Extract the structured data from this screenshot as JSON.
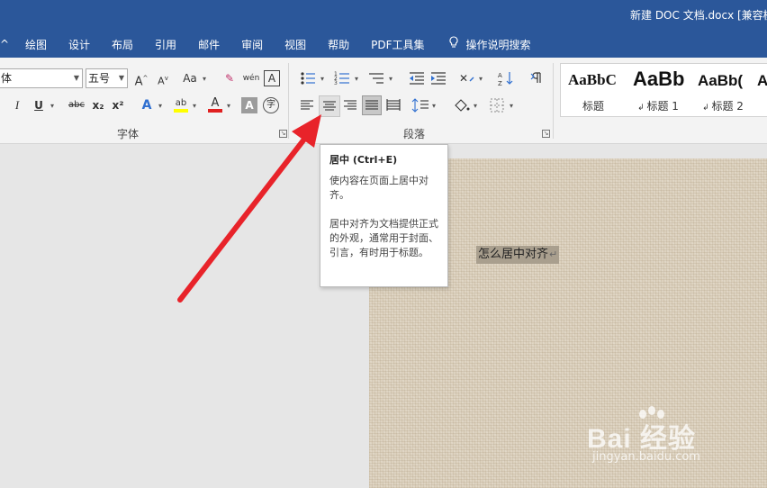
{
  "window": {
    "title": "新建 DOC 文档.docx [兼容模"
  },
  "menu": {
    "items": [
      "^",
      "绘图",
      "设计",
      "布局",
      "引用",
      "邮件",
      "审阅",
      "视图",
      "帮助",
      "PDF工具集"
    ],
    "search_label": "操作说明搜索",
    "search_icon": "lightbulb-icon"
  },
  "ribbon": {
    "font_name": "体",
    "font_size": "五号",
    "font_group_label": "字体",
    "paragraph_group_label": "段落",
    "font_buttons": {
      "grow": "A",
      "shrink": "A",
      "change_case": "Aa",
      "clear": "✎",
      "phonetic": "wén",
      "border_char": "A",
      "italic": "I",
      "underline": "U",
      "strike": "abc",
      "subscript": "x₂",
      "superscript": "x²",
      "text_effect": "A",
      "highlight": "ab",
      "font_color": "A",
      "char_shading": "A",
      "enclose": "字"
    },
    "colors": {
      "highlight": "#ffff00",
      "font_color": "#e02020",
      "accent": "#2b579a"
    },
    "styles": [
      {
        "sample": "AaBbC",
        "name": "标题"
      },
      {
        "sample": "AaBb",
        "name": "标题 1"
      },
      {
        "sample": "AaBb(",
        "name": "标题 2"
      },
      {
        "sample": "A",
        "name": ""
      }
    ]
  },
  "tooltip": {
    "title": "居中 (Ctrl+E)",
    "line1": "使内容在页面上居中对齐。",
    "line2": "居中对齐为文档提供正式的外观，通常用于封面、引言，有时用于标题。"
  },
  "document": {
    "selected_text": "怎么居中对齐",
    "paragraph_mark": "↵"
  },
  "watermark": {
    "main": "Bai 经验",
    "sub": "jingyan.baidu.com"
  }
}
